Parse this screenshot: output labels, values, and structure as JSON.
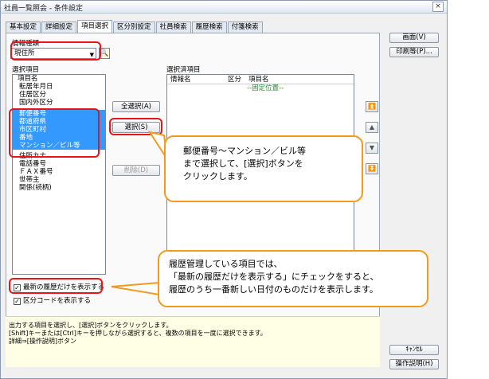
{
  "window": {
    "title": "社員一覧照会 - 条件設定",
    "close_label": "×"
  },
  "tabs": [
    "基本設定",
    "詳細設定",
    "項目選択",
    "区分別設定",
    "社員検索",
    "履歴検索",
    "付箋検索"
  ],
  "info_type": {
    "label": "情報種類",
    "selected": "現住所"
  },
  "available": {
    "label": "選択項目",
    "items": [
      "項目名",
      "転居年月日",
      "住居区分",
      "国内外区分",
      "郵便番号",
      "都道府県",
      "市区町村",
      "番地",
      "マンション／ビル等",
      "住所カナ",
      "電話番号",
      "ＦＡＸ番号",
      "世帯主",
      "関係(続柄)"
    ]
  },
  "selected": {
    "label": "選択済項目",
    "columns": [
      "情報名",
      "区分",
      "項目名"
    ],
    "fixed_row": "--固定位置--"
  },
  "buttons": {
    "select_all": "全選択(A)",
    "select": "選択(S)",
    "delete": "削除(D)",
    "screen": "画面(V)",
    "print": "印刷等(P)...",
    "cancel": "ｷｬﾝｾﾙ",
    "help": "操作説明(H)"
  },
  "checkboxes": {
    "latest_only": {
      "label": "最新の履歴だけを表示する",
      "checked": true
    },
    "show_code": {
      "label": "区分コードを表示する",
      "checked": true
    }
  },
  "help_text": [
    "出力する項目を選択し、[選択]ボタンをクリックします。",
    "[Shift]キーまたは[Ctrl]キーを押しながら選択すると、複数の項目を一度に選択できます。",
    "詳細⇒[操作説明]ボタン"
  ],
  "callouts": {
    "top": [
      "郵便番号～マンション／ビル等",
      "まで選択して、[選択]ボタンを",
      "クリックします。"
    ],
    "bottom": [
      "履歴管理している項目では、",
      "「最新の履歴だけを表示する」にチェックをすると、",
      "履歴のうち一番新しい日付のものだけを表示します。"
    ]
  },
  "colors": {
    "selection": "#3399ff",
    "highlight": "#e8141c",
    "callout_border": "#f39a1e"
  }
}
